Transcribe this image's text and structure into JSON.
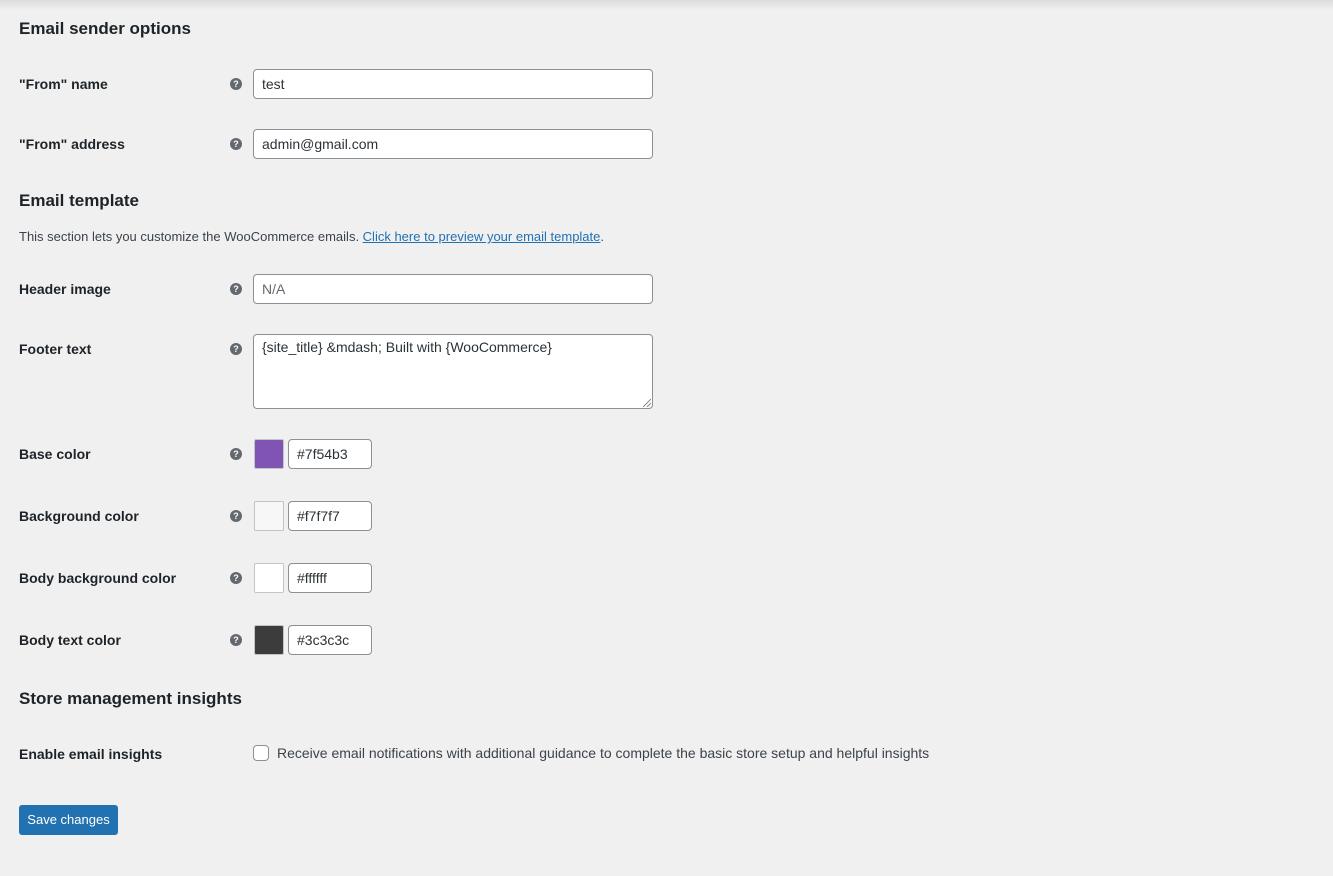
{
  "sections": {
    "sender": {
      "title": "Email sender options"
    },
    "template": {
      "title": "Email template",
      "description": "This section lets you customize the WooCommerce emails. ",
      "preview_link": "Click here to preview your email template",
      "description_end": "."
    },
    "insights": {
      "title": "Store management insights"
    }
  },
  "fields": {
    "from_name": {
      "label": "\"From\" name",
      "value": "test"
    },
    "from_address": {
      "label": "\"From\" address",
      "value": "admin@gmail.com"
    },
    "header_image": {
      "label": "Header image",
      "placeholder": "N/A"
    },
    "footer_text": {
      "label": "Footer text",
      "value": "{site_title} &mdash; Built with {WooCommerce}"
    },
    "base_color": {
      "label": "Base color",
      "value": "#7f54b3"
    },
    "background_color": {
      "label": "Background color",
      "value": "#f7f7f7"
    },
    "body_background_color": {
      "label": "Body background color",
      "value": "#ffffff"
    },
    "body_text_color": {
      "label": "Body text color",
      "value": "#3c3c3c"
    },
    "email_insights": {
      "label": "Enable email insights",
      "checkbox_label": "Receive email notifications with additional guidance to complete the basic store setup and helpful insights",
      "checked": false
    }
  },
  "help_icon": "?",
  "save_button": "Save changes",
  "colors": {
    "page_bg": "#f0f0f1",
    "primary_button": "#2271b1",
    "link": "#2271b1"
  }
}
